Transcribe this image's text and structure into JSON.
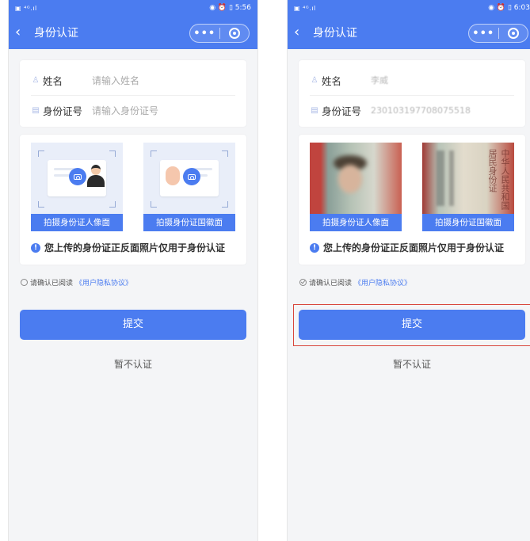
{
  "screens": [
    {
      "status": {
        "left": "▣ ⁴ᴳ.ıl",
        "right": "◉ ⏰ ▯ 5:56"
      },
      "nav": {
        "title": "身份认证",
        "more": "•••"
      },
      "form": {
        "name_label": "姓名",
        "name_placeholder": "请输入姓名",
        "id_label": "身份证号",
        "id_placeholder": "请输入身份证号"
      },
      "id_photos": {
        "front_caption": "拍摄身份证人像面",
        "back_caption": "拍摄身份证国徽面",
        "notice": "您上传的身份证正反面照片仅用于身份认证"
      },
      "agreement": {
        "text": "请确认已阅读",
        "link": "《用户隐私协议》",
        "checked": false
      },
      "actions": {
        "submit": "提交",
        "skip": "暂不认证"
      }
    },
    {
      "status": {
        "left": "▣ ⁴ᴳ.ıl",
        "right": "◉ ⏰ ▯ 6:03"
      },
      "nav": {
        "title": "身份认证",
        "more": "•••"
      },
      "form": {
        "name_label": "姓名",
        "name_value": "李威",
        "id_label": "身份证号",
        "id_value": "230103197708075518"
      },
      "id_photos": {
        "front_caption": "拍摄身份证人像面",
        "back_caption": "拍摄身份证国徽面",
        "notice": "您上传的身份证正反面照片仅用于身份认证",
        "back_photo_text": "中华人民共和国 居民身份证"
      },
      "agreement": {
        "text": "请确认已阅读",
        "link": "《用户隐私协议》",
        "checked": true
      },
      "actions": {
        "submit": "提交",
        "skip": "暂不认证"
      },
      "highlight": {
        "target": "submit-button",
        "color": "#d9463b"
      }
    }
  ],
  "colors": {
    "primary": "#4b7cf0",
    "highlight": "#d9463b",
    "background": "#f4f5f7"
  }
}
